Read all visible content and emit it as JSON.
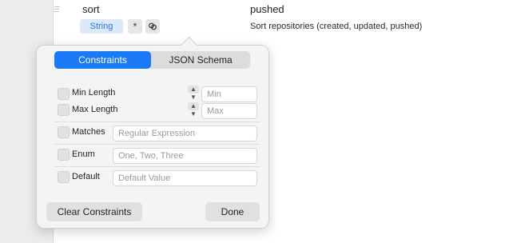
{
  "row": {
    "name": "sort",
    "value": "pushed",
    "type_badge": "String",
    "required_symbol": "*",
    "description": "Sort repositories (created, updated, pushed)"
  },
  "popover": {
    "tabs": [
      {
        "label": "Constraints",
        "active": true
      },
      {
        "label": "JSON Schema",
        "active": false
      }
    ],
    "min_length": {
      "label": "Min Length",
      "placeholder": "Min"
    },
    "max_length": {
      "label": "Max Length",
      "placeholder": "Max"
    },
    "matches": {
      "label": "Matches",
      "placeholder": "Regular Expression"
    },
    "enum": {
      "label": "Enum",
      "placeholder": "One, Two, Three"
    },
    "default": {
      "label": "Default",
      "placeholder": "Default Value"
    },
    "clear_button": "Clear Constraints",
    "done_button": "Done"
  },
  "colors": {
    "accent": "#1a7af5",
    "badge_bg": "#dbe9fb",
    "badge_text": "#2f6fd6"
  }
}
